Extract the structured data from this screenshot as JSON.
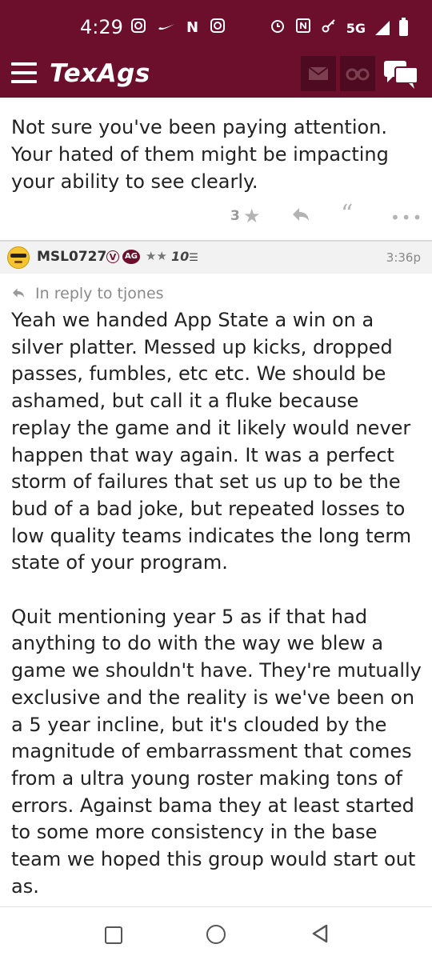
{
  "status_bar": {
    "time": "4:29",
    "network": "5G",
    "icons_left": [
      "instagram-icon",
      "nike-icon",
      "netflix-icon",
      "instagram-icon"
    ],
    "icons_right": [
      "alarm-icon",
      "nfc-icon",
      "key-icon",
      "signal-icon",
      "battery-icon"
    ]
  },
  "app_header": {
    "logo": "TexAgs",
    "brand_color": "#6b0f2d"
  },
  "previous_post": {
    "text": "Not sure you've been paying attention. Your hated of them might be impacting your ability to see clearly.",
    "star_count": "3"
  },
  "post": {
    "username": "MSL0727",
    "badge_v": "V",
    "badge_ag": "AG",
    "stars": "★★",
    "rank": "10",
    "time": "3:36p",
    "reply_to": "In reply to tjones",
    "paragraph_1": "Yeah we handed App State a win on a silver platter. Messed up kicks, dropped passes, fumbles, etc etc. We should be ashamed, but call it a fluke because replay the game and it likely would never happen that way again. It was a perfect storm of failures that set us up to be the bud of a bad joke, but repeated losses to low quality teams indicates the long term state of your program.",
    "paragraph_2": "Quit mentioning year 5 as if that had anything to do with the way we blew a game we shouldn't have. They're mutually exclusive and the reality is we've been on a 5 year incline, but it's clouded by the magnitude of embarrassment that comes from a ultra young roster making tons of errors. Against bama they at least started to some more consistency in the base team we hoped this group would start out as."
  }
}
